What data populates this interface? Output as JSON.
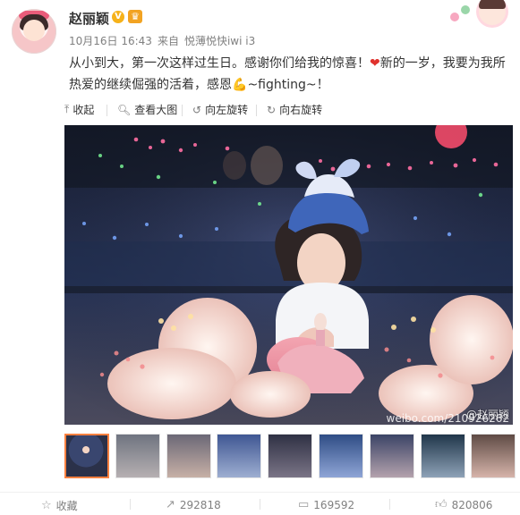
{
  "post": {
    "username": "赵丽颖",
    "verified_badge": "V",
    "member_badge": "♛",
    "timestamp": "10月16日 16:43",
    "source_prefix": "来自",
    "source": "悦薄悦快iwi i3",
    "text_part1": "从小到大，第一次这样过生日。感谢你们给我的惊喜！",
    "heart": "❤",
    "text_part2": "新的一岁，我要为我所热爱的继续倔强的活着，感恩",
    "flex_emoji": "💪",
    "text_part3": "~fighting~！"
  },
  "toolbar": {
    "collapse": "收起",
    "view_large": "查看大图",
    "rotate_left": "向左旋转",
    "rotate_right": "向右旋转"
  },
  "photo": {
    "watermark": "@赵丽颖",
    "watermark_url": "weibo.com/210926262"
  },
  "thumbnails": [
    {
      "active": true,
      "tone": "#2b3149"
    },
    {
      "active": false,
      "tone": "#8f95a6"
    },
    {
      "active": false,
      "tone": "#9d8f89"
    },
    {
      "active": false,
      "tone": "#4a5a86"
    },
    {
      "active": false,
      "tone": "#3a3d52"
    },
    {
      "active": false,
      "tone": "#41527c"
    },
    {
      "active": false,
      "tone": "#4f5577"
    },
    {
      "active": false,
      "tone": "#2b4b67"
    },
    {
      "active": false,
      "tone": "#9a7b72"
    }
  ],
  "actions": {
    "favorite": "收藏",
    "forward_count": "292818",
    "comment_count": "169592",
    "like_count": "820806"
  },
  "icons": {
    "collapse": "arrow-up-icon",
    "view_large": "search-icon",
    "rotate_left": "rotate-left-icon",
    "rotate_right": "rotate-right-icon",
    "favorite": "star-icon",
    "forward": "forward-icon",
    "comment": "comment-icon",
    "like": "thumbs-up-icon"
  },
  "colors": {
    "accent_orange": "#ff8140",
    "verified_gold": "#f6b21a",
    "heart_red": "#e0322d"
  }
}
